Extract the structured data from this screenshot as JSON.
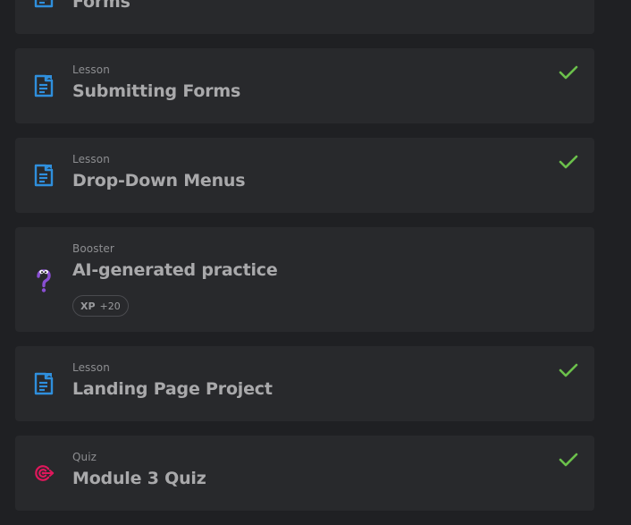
{
  "colors": {
    "background": "#1f2023",
    "card": "#28292c",
    "lesson_icon": "#2f8fdd",
    "check": "#6bc04b",
    "quiz_icon": "#e0175c",
    "booster_icon": "#8a4fd3"
  },
  "items": [
    {
      "kind": "",
      "title": "Forms",
      "icon": "document-icon",
      "completed": true
    },
    {
      "kind": "Lesson",
      "title": "Submitting Forms",
      "icon": "document-icon",
      "completed": true
    },
    {
      "kind": "Lesson",
      "title": "Drop-Down Menus",
      "icon": "document-icon",
      "completed": true
    },
    {
      "kind": "Booster",
      "title": "AI-generated practice",
      "icon": "question-mark-icon",
      "completed": false,
      "xp_label": "XP",
      "xp_value": "+20"
    },
    {
      "kind": "Lesson",
      "title": "Landing Page Project",
      "icon": "document-icon",
      "completed": true
    },
    {
      "kind": "Quiz",
      "title": "Module 3 Quiz",
      "icon": "target-icon",
      "completed": true
    }
  ]
}
